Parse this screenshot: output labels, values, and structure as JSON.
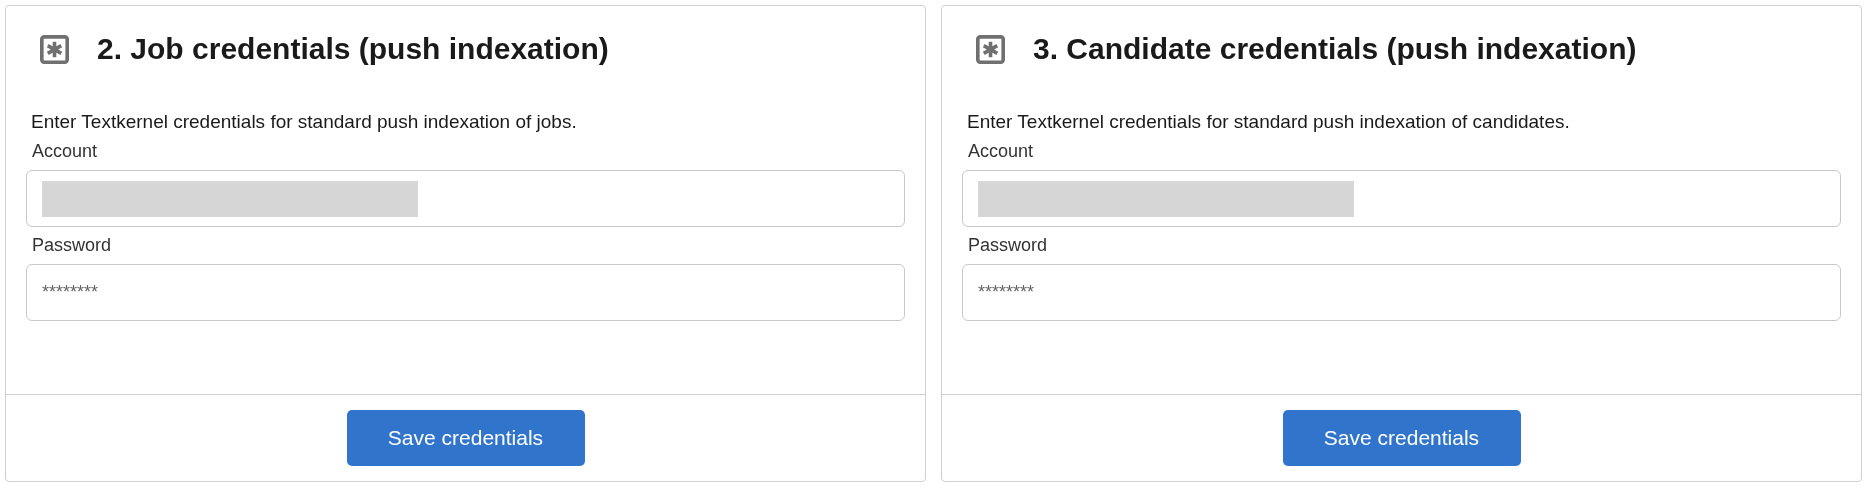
{
  "cards": [
    {
      "title": "2. Job credentials (push indexation)",
      "description": "Enter Textkernel credentials for standard push indexation of jobs.",
      "fields": [
        {
          "label": "Account",
          "kind": "redacted"
        },
        {
          "label": "Password",
          "kind": "password",
          "placeholder": "********"
        }
      ],
      "button": "Save credentials"
    },
    {
      "title": "3. Candidate credentials (push indexation)",
      "description": "Enter Textkernel credentials for standard push indexation of candidates.",
      "fields": [
        {
          "label": "Account",
          "kind": "redacted"
        },
        {
          "label": "Password",
          "kind": "password",
          "placeholder": "********"
        }
      ],
      "button": "Save credentials"
    }
  ]
}
